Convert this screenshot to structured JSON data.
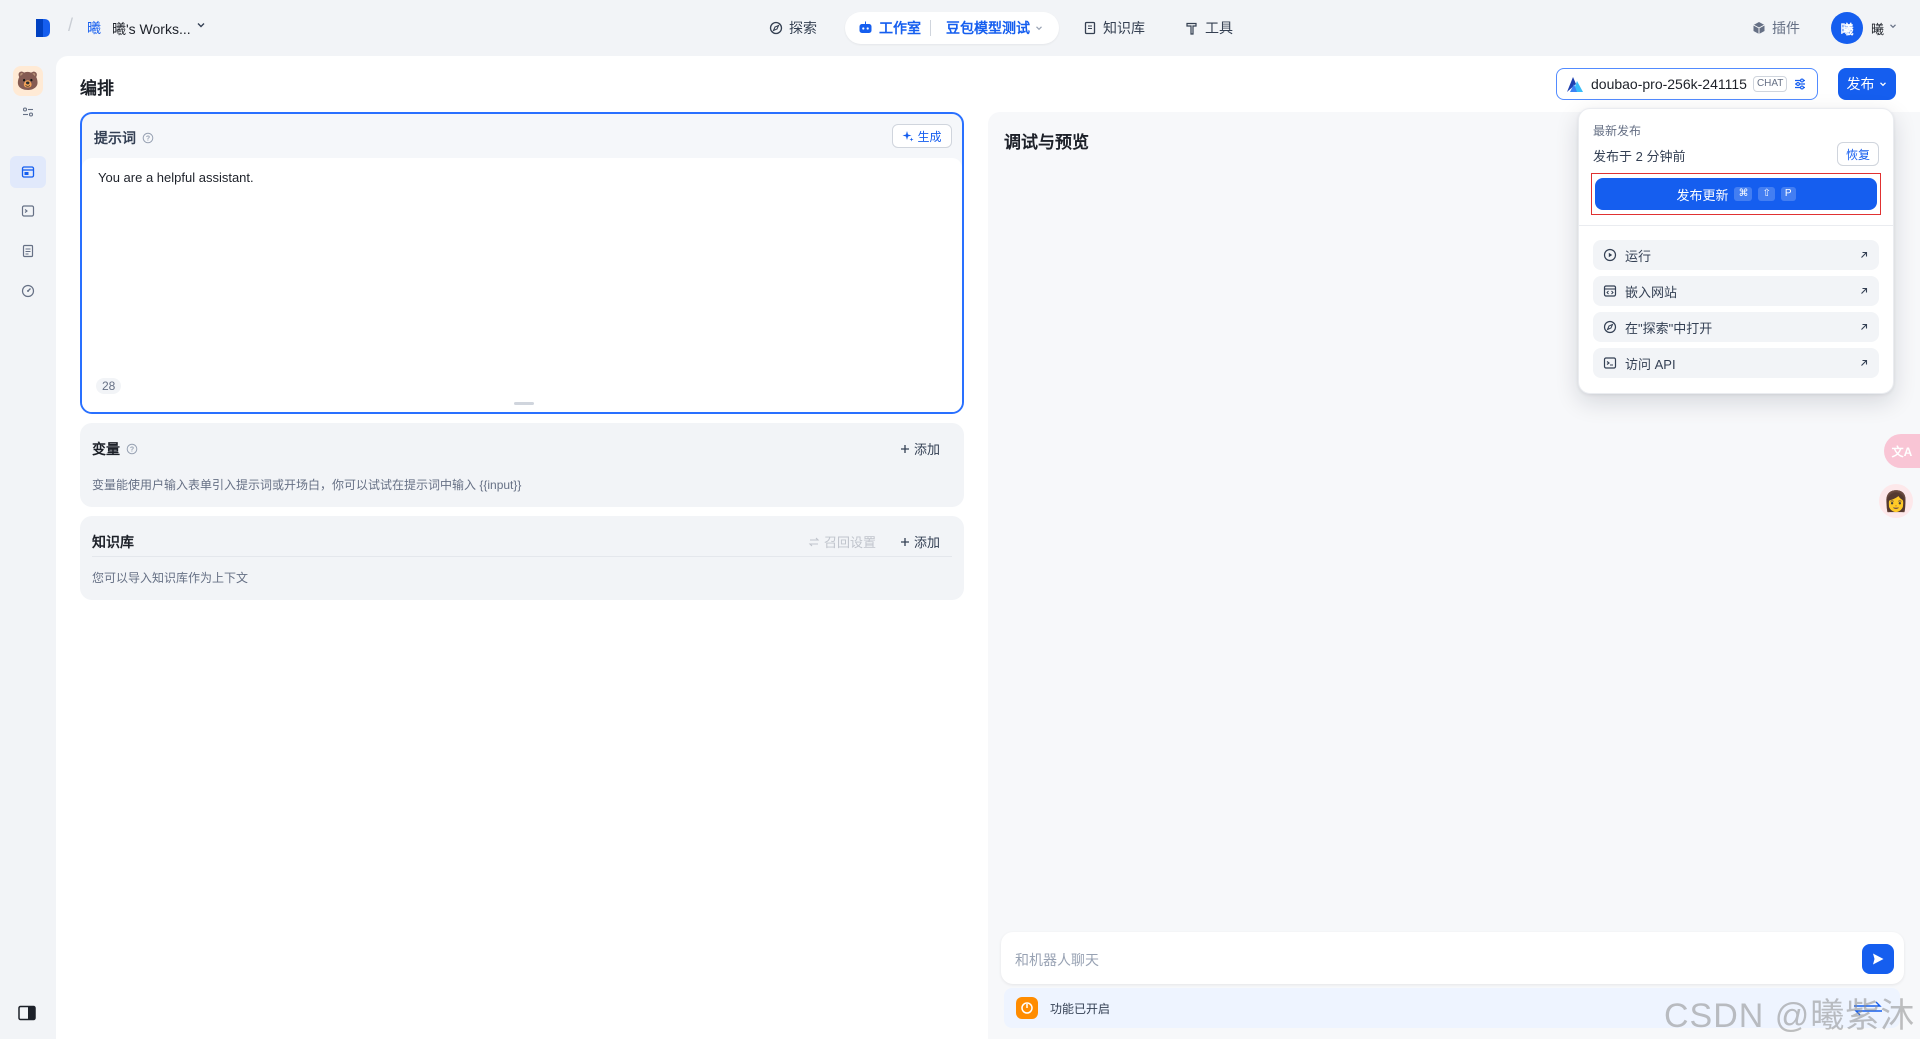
{
  "header": {
    "workspace_icon": "曦",
    "workspace_name": "曦's Works...",
    "nav": [
      {
        "label": "探索",
        "icon": "compass-icon"
      },
      {
        "label": "工作室",
        "icon": "robot-icon"
      },
      {
        "label": "知识库",
        "icon": "book-icon"
      },
      {
        "label": "工具",
        "icon": "hammer-icon"
      }
    ],
    "current_app": "豆包模型测试",
    "plugin_label": "插件",
    "avatar_text": "曦",
    "user_name": "曦"
  },
  "page": {
    "title": "编排",
    "model_name": "doubao-pro-256k-241115",
    "model_badge": "CHAT",
    "publish_label": "发布"
  },
  "prompt": {
    "label": "提示词",
    "generate_label": "生成",
    "text": "You are a helpful assistant.",
    "count": "28"
  },
  "variables": {
    "title": "变量",
    "add_label": "添加",
    "description": "变量能使用户输入表单引入提示词或开场白，你可以试试在提示词中输入 {{input}}"
  },
  "knowledge": {
    "title": "知识库",
    "recall_label": "召回设置",
    "add_label": "添加",
    "description": "您可以导入知识库作为上下文"
  },
  "debug": {
    "title": "调试与预览",
    "input_placeholder": "和机器人聊天",
    "feature_text": "功能已开启"
  },
  "publish_menu": {
    "latest_label": "最新发布",
    "published_time": "发布于 2 分钟前",
    "restore_label": "恢复",
    "update_label": "发布更新",
    "shortcut_keys": [
      "⌘",
      "⇧",
      "P"
    ],
    "items": [
      {
        "label": "运行",
        "icon": "play-circle-icon"
      },
      {
        "label": "嵌入网站",
        "icon": "embed-icon"
      },
      {
        "label": "在\"探索\"中打开",
        "icon": "compass-icon"
      },
      {
        "label": "访问 API",
        "icon": "terminal-icon"
      }
    ]
  },
  "floating": {
    "translate_text": "文A"
  },
  "watermark": "CSDN @曦紫沐",
  "colors": {
    "primary": "#155eef",
    "highlight_border": "#e03131",
    "feature_orange": "#ff8c00"
  }
}
